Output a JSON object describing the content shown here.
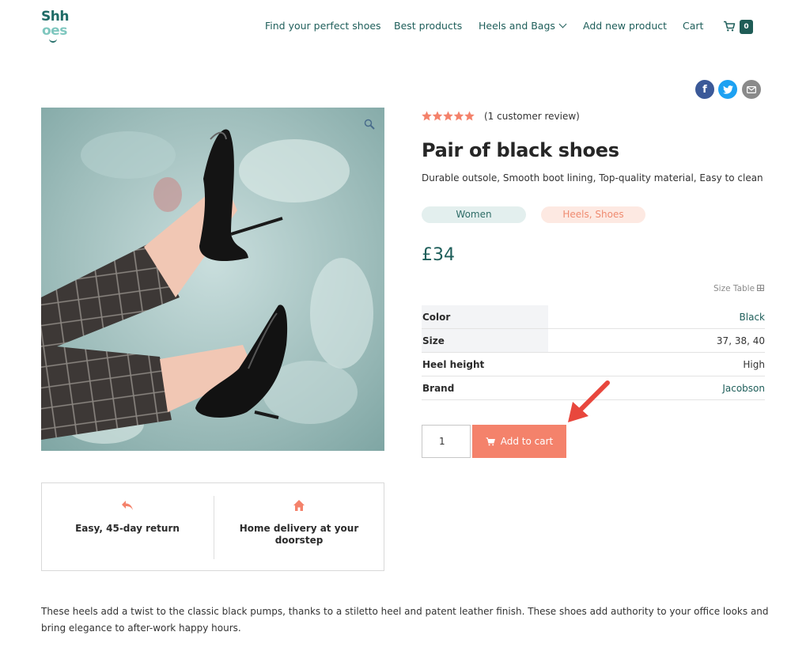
{
  "brand": {
    "logo_top": "Shh",
    "logo_bottom": "oes"
  },
  "nav": {
    "items": [
      {
        "label": "Find your perfect shoes"
      },
      {
        "label": "Best products"
      },
      {
        "label": "Heels and Bags"
      },
      {
        "label": "Add new product"
      },
      {
        "label": "Cart"
      }
    ],
    "cart_count": "0"
  },
  "share": {
    "facebook_icon": "f",
    "twitter_icon": "twitter-bird",
    "email_icon": "envelope"
  },
  "product": {
    "rating": 5,
    "review_text": "(1 customer review)",
    "title": "Pair of black shoes",
    "short_description": "Durable outsole, Smooth boot lining, Top-quality material, Easy to clean",
    "tags": {
      "category": "Women",
      "subcategory": "Heels, Shoes"
    },
    "price": "£34",
    "size_table_label": "Size Table",
    "attributes": [
      {
        "label": "Color",
        "value": "Black"
      },
      {
        "label": "Size",
        "value": "37, 38, 40"
      },
      {
        "label": "Heel height",
        "value": "High"
      },
      {
        "label": "Brand",
        "value": "Jacobson"
      }
    ],
    "quantity": "1",
    "add_to_cart_label": "Add to cart"
  },
  "features": [
    {
      "text": "Easy, 45-day return"
    },
    {
      "text": "Home delivery at your doorstep"
    }
  ],
  "long_description": "These heels add a twist to the classic black pumps, thanks to a stiletto heel and patent leather finish. These shoes add authority to your office looks and bring elegance to after-work happy hours.",
  "colors": {
    "brand_teal": "#1e5e5a",
    "accent_coral": "#f4826b",
    "star": "#f4826b"
  }
}
